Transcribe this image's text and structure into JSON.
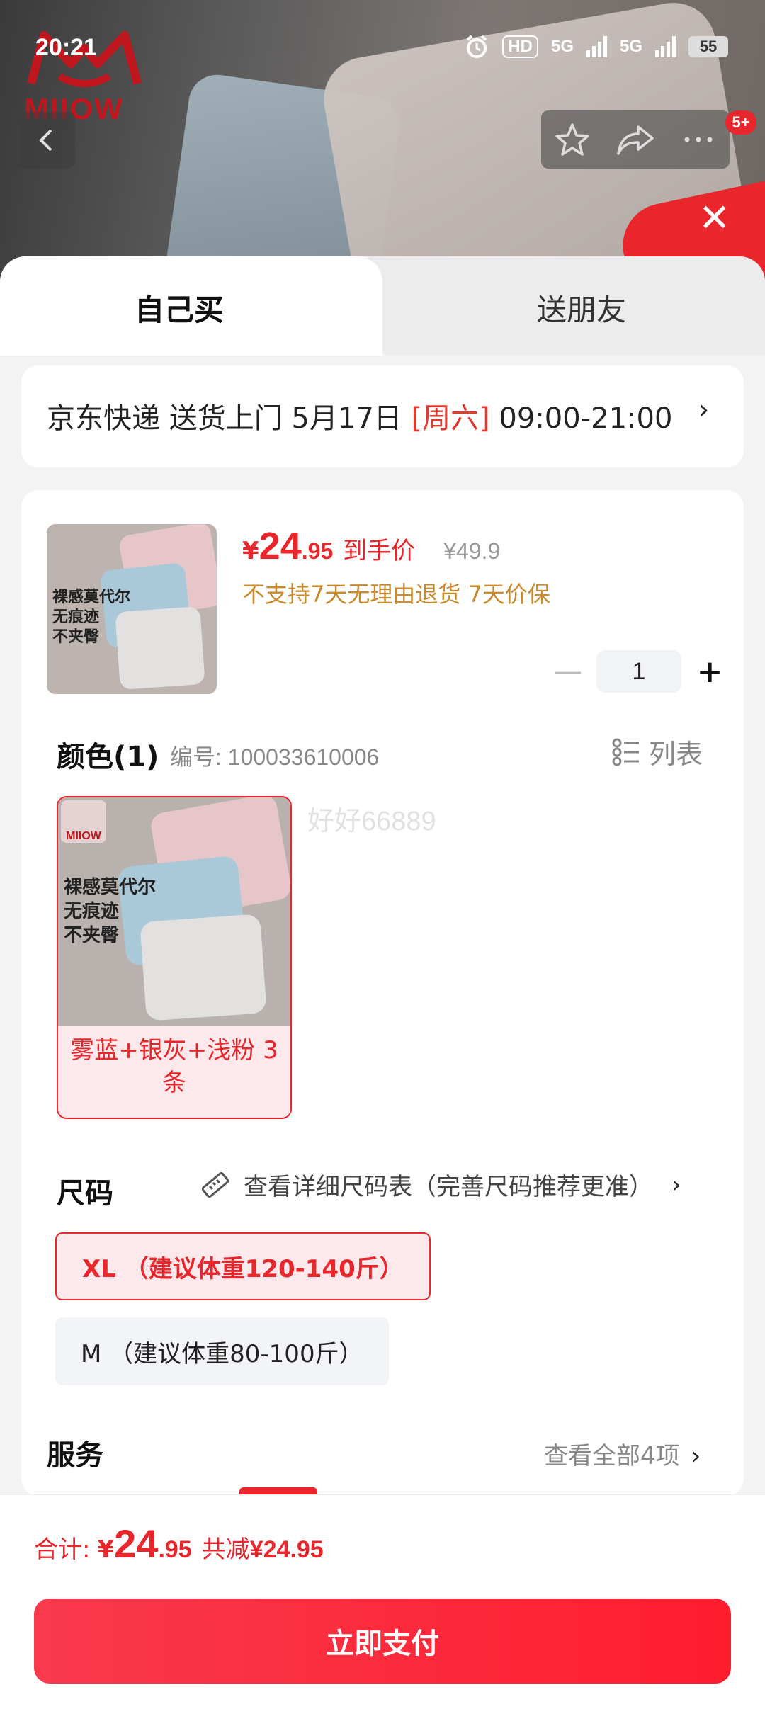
{
  "status_bar": {
    "time": "20:21",
    "hd": "HD",
    "net1": "5G",
    "net2": "5G",
    "battery": "55"
  },
  "hero": {
    "brand": "MIIOW",
    "badge": "5+"
  },
  "tabs": [
    {
      "label": "自己买"
    },
    {
      "label": "送朋友"
    }
  ],
  "delivery": {
    "prefix": "京东快递 送货上门 5月17日 ",
    "weekday": "[周六]",
    "time_window": " 09:00-21:00"
  },
  "product": {
    "thumb_text": "裸感莫代尔\n无痕迹\n不夹臀",
    "price_symbol": "¥",
    "price_int": "24",
    "price_dec": ".95",
    "price_tag": "到手价",
    "original_price": "¥49.9",
    "policy": "不支持7天无理由退货  7天价保",
    "quantity": "1"
  },
  "color_section": {
    "title": "颜色(1)",
    "sku_no": "编号: 100033610006",
    "list_label": "列表",
    "watermark": "好好66889",
    "variant_label": "雾蓝+银灰+浅粉 3条",
    "variant_img_text": "裸感莫代尔\n无痕迹\n不夹臀",
    "variant_logo": "MIIOW"
  },
  "size_section": {
    "title": "尺码",
    "chart_link": "查看详细尺码表（完善尺码推荐更准）",
    "options": [
      {
        "label": "XL （建议体重120-140斤）",
        "selected": true
      },
      {
        "label": "M （建议体重80-100斤）",
        "selected": false
      }
    ]
  },
  "service_section": {
    "title": "服务",
    "more": "查看全部4项"
  },
  "footer": {
    "total_label": "合计:",
    "total_symbol": "¥",
    "total_int": "24",
    "total_dec": ".95",
    "save_label": "共减",
    "save_amount": "¥24.95",
    "pay_label": "立即支付"
  },
  "colors": {
    "accent": "#e8262b",
    "policy": "#c88a2c",
    "selected_bg": "#fde9ec"
  }
}
